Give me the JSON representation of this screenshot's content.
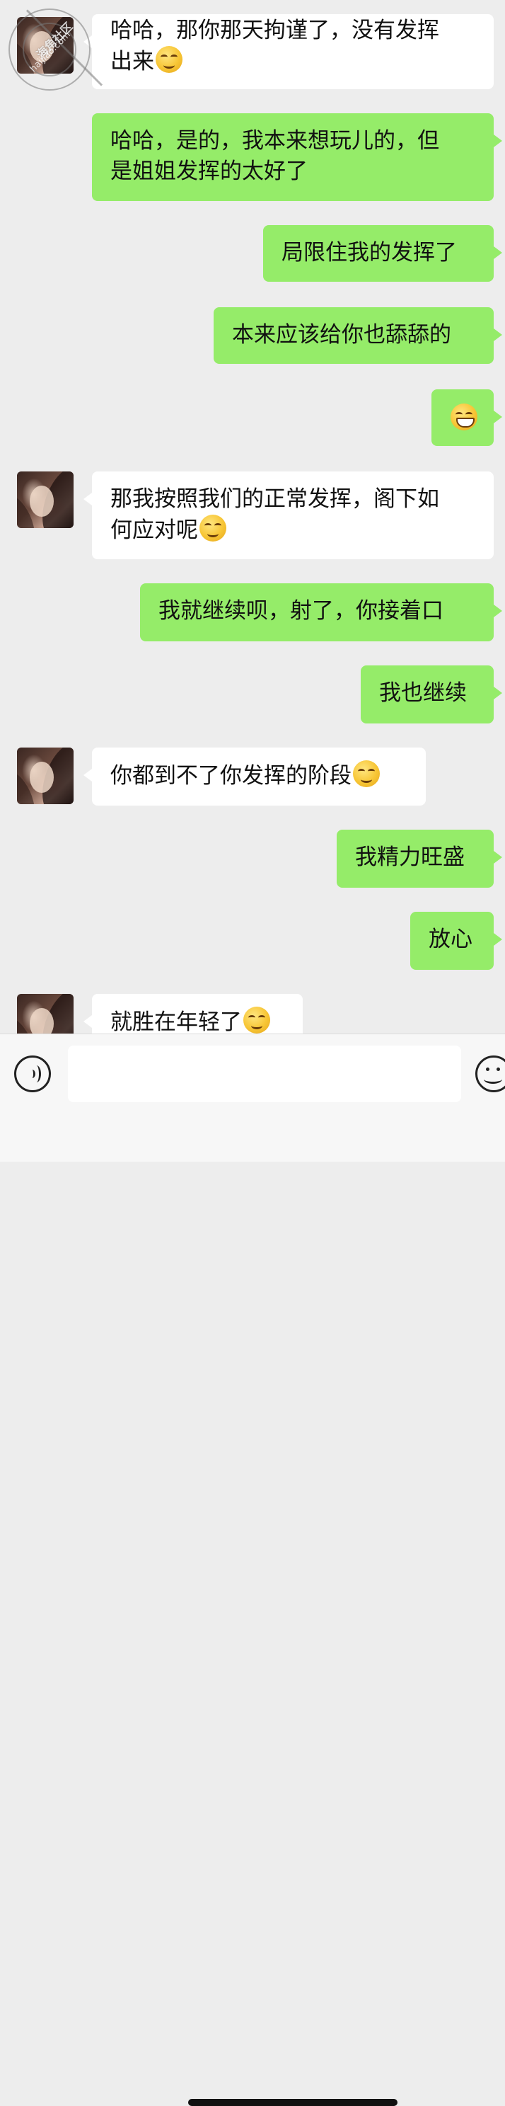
{
  "watermark": {
    "line1": "海角社区",
    "line2": "haijiao.com"
  },
  "messages": [
    {
      "side": "in",
      "text": "哈哈，那你那天拘谨了，没有发挥",
      "text2": "出来",
      "emoji": "smirk-emoji"
    },
    {
      "side": "out",
      "text": "哈哈，是的，我本来想玩儿的，但",
      "text2": "是姐姐发挥的太好了"
    },
    {
      "side": "out",
      "text": "局限住我的发挥了"
    },
    {
      "side": "out",
      "text": "本来应该给你也舔舔的"
    },
    {
      "side": "out",
      "emoji": "grin-emoji"
    },
    {
      "side": "in",
      "text": "那我按照我们的正常发挥，阁下如",
      "text2": "何应对呢",
      "emoji": "smirk-emoji"
    },
    {
      "side": "out",
      "text": "我就继续呗，射了，你接着口"
    },
    {
      "side": "out",
      "text": "我也继续"
    },
    {
      "side": "in",
      "text": "你都到不了你发挥的阶段",
      "emoji": "smirk-emoji"
    },
    {
      "side": "out",
      "text": "我精力旺盛"
    },
    {
      "side": "out",
      "text": "放心"
    },
    {
      "side": "in",
      "text": "就胜在年轻了",
      "emoji": "smirk-emoji"
    }
  ],
  "input": {
    "value": "",
    "placeholder": ""
  },
  "icons": {
    "voice": "voice-icon",
    "emoji": "emoji-icon"
  },
  "colors": {
    "outgoing_bubble": "#95ec69",
    "incoming_bubble": "#ffffff",
    "background": "#ededed"
  }
}
